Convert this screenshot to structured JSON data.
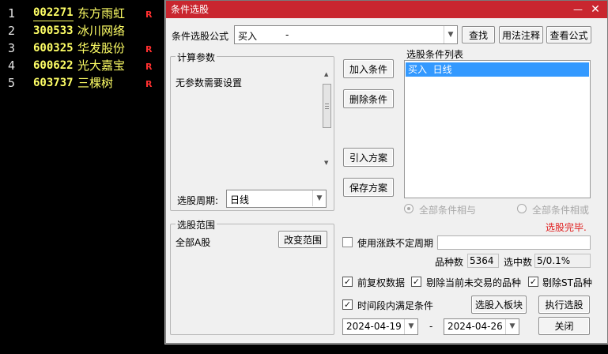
{
  "stock_list": [
    {
      "index": "1",
      "code": "002271",
      "name": "东方雨虹",
      "flag": "R"
    },
    {
      "index": "2",
      "code": "300533",
      "name": "冰川网络",
      "flag": ""
    },
    {
      "index": "3",
      "code": "600325",
      "name": "华发股份",
      "flag": "R"
    },
    {
      "index": "4",
      "code": "600622",
      "name": "光大嘉宝",
      "flag": "R"
    },
    {
      "index": "5",
      "code": "603737",
      "name": "三棵树",
      "flag": "R"
    }
  ],
  "dialog": {
    "title": "条件选股",
    "minimize_glyph": "—",
    "close_glyph": "✕",
    "formula": {
      "label": "条件选股公式",
      "value": "买入",
      "value_suffix": "-",
      "find_button": "查找",
      "usage_button": "用法注释",
      "view_formula_button": "查看公式"
    },
    "params": {
      "group_title": "计算参数",
      "message": "无参数需要设置",
      "period_label": "选股周期:",
      "period_value": "日线"
    },
    "buttons": {
      "add_condition": "加入条件",
      "delete_condition": "删除条件",
      "import_plan": "引入方案",
      "save_plan": "保存方案",
      "change_scope": "改变范围",
      "select_to_block": "选股入板块",
      "execute": "执行选股",
      "close": "关闭"
    },
    "condition_list": {
      "title": "选股条件列表",
      "items": [
        "买入  日线"
      ]
    },
    "logic": {
      "and_label": "全部条件相与",
      "or_label": "全部条件相或"
    },
    "status": {
      "text": "选股完毕.",
      "color": "#e02020"
    },
    "scope": {
      "group_title": "选股范围",
      "value": "全部A股"
    },
    "options": {
      "variable_period_label": "使用涨跌不定周期",
      "stock_count_label": "品种数",
      "stock_count_value": "5364",
      "selected_label": "选中数",
      "selected_value": "5/0.1%",
      "forward_adjust_label": "前复权数据",
      "exclude_untraded_label": "剔除当前未交易的品种",
      "exclude_st_label": "剔除ST品种",
      "time_range_label": "时间段内满足条件",
      "check_glyph": "✓"
    },
    "dates": {
      "start": "2024-04-19",
      "separator": "-",
      "end": "2024-04-26"
    },
    "colors": {
      "title_bar": "#c9262f",
      "list_highlight": "#3399ff",
      "stock_code": "#ffff66",
      "flag_red": "#ff3030"
    }
  }
}
